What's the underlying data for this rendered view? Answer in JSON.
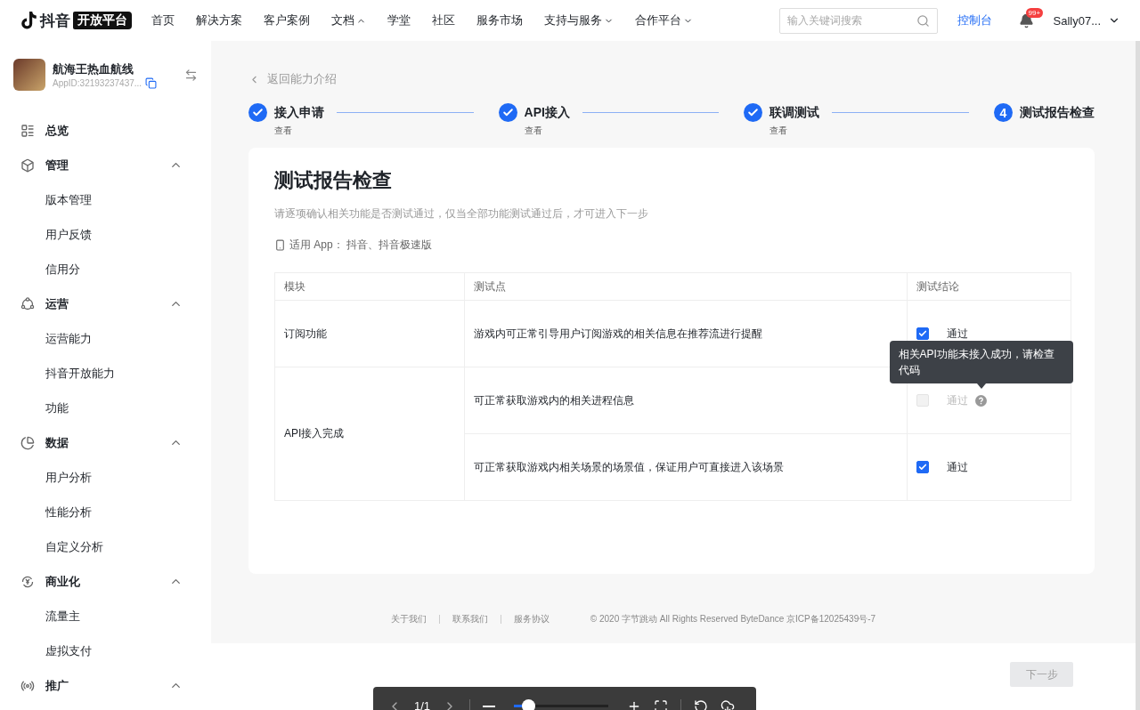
{
  "header": {
    "logo": {
      "name": "抖音",
      "tag": "开放平台"
    },
    "nav": [
      {
        "label": "首页"
      },
      {
        "label": "解决方案"
      },
      {
        "label": "客户案例"
      },
      {
        "label": "文档",
        "expanded": true
      },
      {
        "label": "学堂"
      },
      {
        "label": "社区"
      },
      {
        "label": "服务市场"
      },
      {
        "label": "支持与服务",
        "expanded": false
      },
      {
        "label": "合作平台",
        "expanded": false
      }
    ],
    "search": {
      "placeholder": "输入关键词搜索"
    },
    "console_link": "控制台",
    "notifications": {
      "badge": "99+"
    },
    "user": "Sally07..."
  },
  "app": {
    "name": "航海王热血航线",
    "app_id": "AppID:32193237437..."
  },
  "sidebar": {
    "items": [
      {
        "label": "总览"
      },
      {
        "label": "管理",
        "expanded": true,
        "children": [
          {
            "label": "版本管理"
          },
          {
            "label": "用户反馈"
          },
          {
            "label": "信用分"
          }
        ]
      },
      {
        "label": "运营",
        "expanded": true,
        "children": [
          {
            "label": "运营能力"
          },
          {
            "label": "抖音开放能力"
          },
          {
            "label": "功能"
          }
        ]
      },
      {
        "label": "数据",
        "expanded": true,
        "children": [
          {
            "label": "用户分析"
          },
          {
            "label": "性能分析"
          },
          {
            "label": "自定义分析"
          }
        ]
      },
      {
        "label": "商业化",
        "expanded": true,
        "children": [
          {
            "label": "流量主"
          },
          {
            "label": "虚拟支付"
          }
        ]
      },
      {
        "label": "推广",
        "expanded": true
      }
    ]
  },
  "back_link": "返回能力介绍",
  "steps": [
    {
      "title": "接入申请",
      "sub": "查看",
      "done": true
    },
    {
      "title": "API接入",
      "sub": "查看",
      "done": true
    },
    {
      "title": "联调测试",
      "sub": "查看",
      "done": true
    },
    {
      "title": "测试报告检查",
      "number": "4",
      "done": false
    }
  ],
  "card": {
    "title": "测试报告检查",
    "description": "请逐项确认相关功能是否测试通过，仅当全部功能测试通过后，才可进入下一步",
    "apps": "适用 App： 抖音、抖音极速版",
    "table": {
      "columns": [
        "模块",
        "测试点",
        "测试结论"
      ],
      "modules": [
        {
          "name": "订阅功能",
          "points": [
            {
              "text": "游戏内可正常引导用户订阅游戏的相关信息在推荐流进行提醒",
              "result": "通过",
              "checked": true,
              "disabled": false
            }
          ]
        },
        {
          "name": "API接入完成",
          "points": [
            {
              "text": "可正常获取游戏内的相关进程信息",
              "result": "通过",
              "checked": false,
              "disabled": true,
              "tooltip": "相关API功能未接入成功，请检查代码"
            },
            {
              "text": "可正常获取游戏内相关场景的场景值，保证用户可直接进入该场景",
              "result": "通过",
              "checked": true,
              "disabled": false
            }
          ]
        }
      ]
    }
  },
  "footer": {
    "links": [
      "关于我们",
      "联系我们",
      "服务协议"
    ],
    "copyright": "© 2020 字节跳动 All Rights Reserved ByteDance 京ICP备12025439号-7"
  },
  "next_button": {
    "label": "下一步",
    "disabled": true
  },
  "viewer_toolbar": {
    "page": "1/1",
    "zoom": {
      "level": 0.15
    }
  }
}
